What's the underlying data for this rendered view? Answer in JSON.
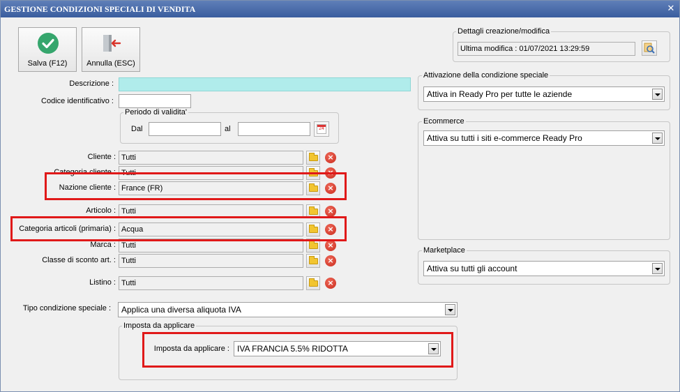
{
  "window": {
    "title": "GESTIONE CONDIZIONI SPECIALI DI VENDITA",
    "close_glyph": "✕"
  },
  "toolbar": {
    "save_label": "Salva (F12)",
    "cancel_label": "Annulla (ESC)"
  },
  "form": {
    "descrizione_label": "Descrizione :",
    "descrizione_value": "",
    "codice_label": "Codice identificativo :",
    "codice_value": "",
    "periodo": {
      "title": "Periodo di validita'",
      "dal_label": "Dal",
      "dal_value": "",
      "al_label": "al",
      "al_value": "",
      "calendar_day": "24"
    },
    "rows": [
      {
        "label": "Cliente :",
        "value": "Tutti"
      },
      {
        "label": "Categoria cliente :",
        "value": "Tutti"
      },
      {
        "label": "Nazione cliente :",
        "value": "France (FR)"
      },
      {
        "label": "Articolo :",
        "value": "Tutti"
      },
      {
        "label": "Categoria articoli (primaria) :",
        "value": "Acqua"
      },
      {
        "label": "Marca :",
        "value": "Tutti"
      },
      {
        "label": "Classe di sconto art. :",
        "value": "Tutti"
      },
      {
        "label": "Listino :",
        "value": "Tutti"
      }
    ],
    "tipo_label": "Tipo condizione speciale :",
    "tipo_value": "Applica una diversa aliquota IVA",
    "imposta_group_title": "Imposta da applicare",
    "imposta_label": "Imposta da applicare :",
    "imposta_value": "IVA FRANCIA 5.5% RIDOTTA"
  },
  "right": {
    "dettagli_title": "Dettagli creazione/modifica",
    "ultima_modifica": "Ultima modifica : 01/07/2021  13:29:59",
    "attivazione_title": "Attivazione della condizione speciale",
    "attivazione_value": "Attiva in Ready Pro per tutte le aziende",
    "ecommerce_title": "Ecommerce",
    "ecommerce_value": "Attiva su tutti i siti e-commerce Ready Pro",
    "marketplace_title": "Marketplace",
    "marketplace_value": "Attiva su tutti gli account"
  },
  "colors": {
    "title_bar": "#3a5d9e",
    "highlight": "#e01919",
    "description_field": "#b0eceb",
    "save_icon": "#36a66d"
  }
}
